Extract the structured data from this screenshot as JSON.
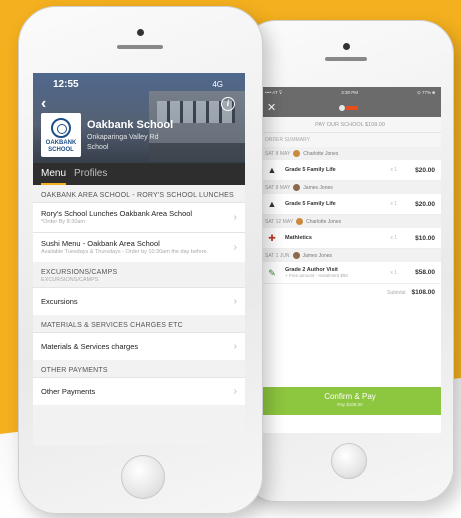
{
  "front": {
    "status": {
      "time": "12:55",
      "signal": "4G"
    },
    "school": {
      "logo_text": "OAKBANK SCHOOL",
      "name": "Oakbank School",
      "address": "Onkaparinga Valley Rd School"
    },
    "tabs": [
      {
        "label": "Menu"
      },
      {
        "label": "Profiles"
      }
    ],
    "sections": [
      {
        "heading": "OAKBANK AREA SCHOOL - RORY'S SCHOOL LUNCHES",
        "items": [
          {
            "title": "Rory's School Lunches Oakbank Area School",
            "desc": "*Order By 8:30am"
          },
          {
            "title": "Sushi Menu - Oakbank Area School",
            "desc": "Available Tuesdays & Thursdays - Order by 10:30am the day before."
          }
        ]
      },
      {
        "heading": "EXCURSIONS/CAMPS",
        "sub": "EXCURSIONS/CAMPS",
        "items": [
          {
            "title": "Excursions"
          }
        ]
      },
      {
        "heading": "MATERIALS & SERVICES CHARGES ETC",
        "items": [
          {
            "title": "Materials & Services charges"
          }
        ]
      },
      {
        "heading": "OTHER PAYMENTS",
        "items": [
          {
            "title": "Other Payments"
          }
        ]
      }
    ]
  },
  "back": {
    "status": {
      "left": "•••• AT ⊽",
      "time": "3:30 PM",
      "right": "⊙ 77% ■"
    },
    "close_glyph": "✕",
    "pay_heading": "PAY OUR SCHOOL $108.00",
    "order_summary": "ORDER SUMMARY",
    "orders": [
      {
        "date": "SAT 8 MAY",
        "student": "Charlotte Jones",
        "avatar": "girl",
        "icon": "▲",
        "product": "Grade 5 Family Life",
        "sub": "",
        "qty": "x 1",
        "price": "$20.00"
      },
      {
        "date": "SAT 8 MAY",
        "student": "James Jones",
        "avatar": "boy",
        "icon": "▲",
        "product": "Grade 5 Family Life",
        "sub": "",
        "qty": "x 1",
        "price": "$20.00"
      },
      {
        "date": "SAT 12 MAY",
        "student": "Charlotte Jones",
        "avatar": "girl",
        "icon": "✚",
        "product": "Mathletics",
        "sub": "",
        "qty": "x 1",
        "price": "$10.00"
      },
      {
        "date": "SAT 1 JUN",
        "student": "James Jones",
        "avatar": "boy",
        "icon": "✎",
        "product": "Grade 2 Author Visit",
        "sub": "+ Free amount - Instalment $50",
        "qty": "x 1",
        "price": "$58.00"
      }
    ],
    "subtotal_label": "Subtotal",
    "subtotal_value": "$108.00",
    "confirm_label": "Confirm & Pay",
    "confirm_sub": "Pay $108.00",
    "colors": {
      "confirm": "#8dc63f",
      "accent": "#f2b11e",
      "background": "#f4b01e"
    }
  }
}
